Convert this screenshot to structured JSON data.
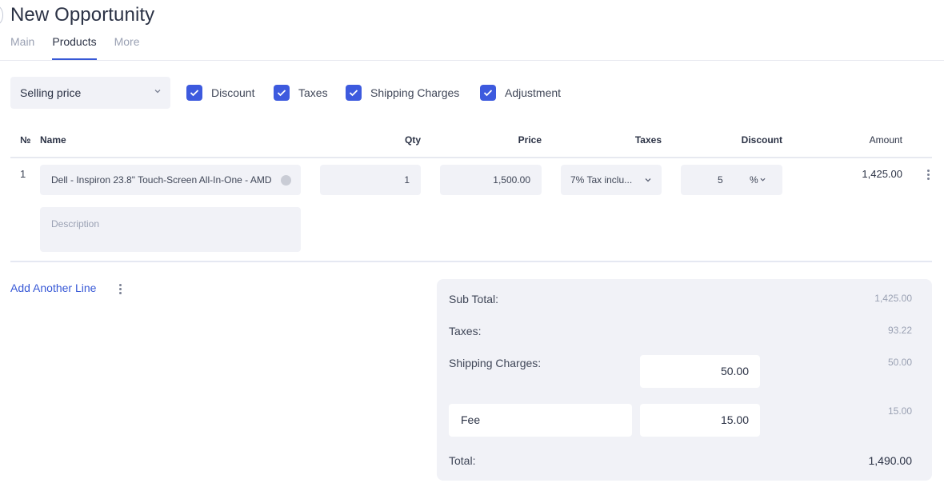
{
  "header": {
    "title": "New Opportunity"
  },
  "tabs": [
    {
      "label": "Main",
      "active": false
    },
    {
      "label": "Products",
      "active": true
    },
    {
      "label": "More",
      "active": false
    }
  ],
  "toolbar": {
    "price_mode": "Selling price",
    "options": [
      {
        "label": "Discount",
        "checked": true
      },
      {
        "label": "Taxes",
        "checked": true
      },
      {
        "label": "Shipping Charges",
        "checked": true
      },
      {
        "label": "Adjustment",
        "checked": true
      }
    ]
  },
  "table": {
    "columns": {
      "no": "№",
      "name": "Name",
      "qty": "Qty",
      "price": "Price",
      "taxes": "Taxes",
      "discount": "Discount",
      "amount": "Amount"
    },
    "rows": [
      {
        "no": "1",
        "name": "Dell - Inspiron 23.8\" Touch-Screen All-In-One - AMD",
        "description_placeholder": "Description",
        "qty": "1",
        "price": "1,500.00",
        "tax": "7% Tax inclu...",
        "discount": "5",
        "discount_unit": "%",
        "amount": "1,425.00"
      }
    ]
  },
  "actions": {
    "add_line": "Add Another Line"
  },
  "totals": {
    "sub_total_label": "Sub Total:",
    "sub_total": "1,425.00",
    "taxes_label": "Taxes:",
    "taxes": "93.22",
    "shipping_label": "Shipping Charges:",
    "shipping_input": "50.00",
    "shipping": "50.00",
    "fee_label": "Fee",
    "fee_input": "15.00",
    "fee": "15.00",
    "total_label": "Total:",
    "total": "1,490.00"
  },
  "colors": {
    "accent": "#3758d6",
    "checkbox": "#3d5ade",
    "field_bg": "#f1f2f7"
  }
}
